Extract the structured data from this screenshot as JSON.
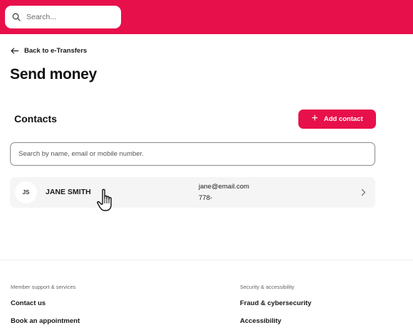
{
  "header": {
    "search_placeholder": "Search..."
  },
  "nav": {
    "back_label": "Back to e-Transfers"
  },
  "page": {
    "title": "Send money"
  },
  "contacts": {
    "heading": "Contacts",
    "add_button_label": "Add contact",
    "search_placeholder": "Search by name, email or mobile number.",
    "items": [
      {
        "initials": "JS",
        "name": "JANE SMITH",
        "email": "jane@email.com",
        "phone": "778-"
      }
    ]
  },
  "footer": {
    "col1": {
      "heading": "Member support & services",
      "links": [
        "Contact us",
        "Book an appointment"
      ]
    },
    "col2": {
      "heading": "Security & accessibility",
      "links": [
        "Fraud & cybersecurity",
        "Accessibility"
      ]
    }
  },
  "colors": {
    "brand": "#e8104a"
  }
}
